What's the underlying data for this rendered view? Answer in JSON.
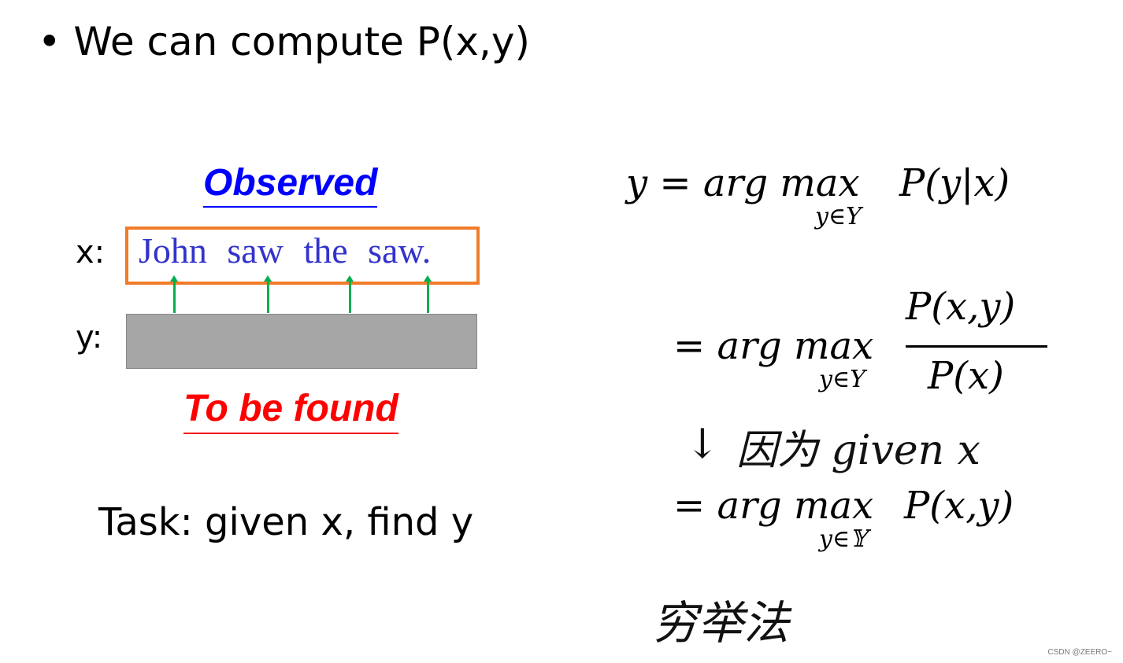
{
  "slide": {
    "bullet": "We can compute P(x,y)",
    "observed_label": "Observed",
    "to_be_found_label": "To be found",
    "x_label": "x:",
    "y_label": "y:",
    "sentence_words": [
      "John",
      "saw",
      "the",
      "saw."
    ],
    "task": "Task: given x, find y",
    "colors": {
      "observed": "#0000ff",
      "to_be_found": "#ff0000",
      "x_box_border": "#f07c2a",
      "y_box_fill": "#a6a6a6",
      "arrows": "#00b050",
      "words": "#3333cc"
    }
  },
  "equations": {
    "line1_lhs": "y = arg max",
    "line1_sub": "y∈Y",
    "line1_rhs": "P(y|x)",
    "line2_lhs": "= arg max",
    "line2_sub": "y∈Y",
    "line2_num": "P(x,y)",
    "line2_den": "P(x)",
    "line3_lhs": "= arg max",
    "line3_sub": "y∈𝕐",
    "line3_rhs": "P(x,y)"
  },
  "annotations": {
    "arrow": "↓",
    "note1": "因为 given x",
    "note2": "穷举法"
  },
  "watermark": "CSDN @ZEERO~"
}
